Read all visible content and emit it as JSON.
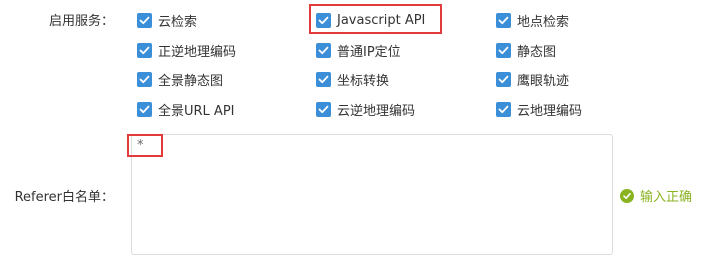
{
  "form": {
    "services_label": "启用服务：",
    "referer_label": "Referer白名单：",
    "referer_value": "*",
    "status_text": "输入正确"
  },
  "services": [
    {
      "label": "云检索",
      "checked": true
    },
    {
      "label": "Javascript API",
      "checked": true,
      "highlighted": true
    },
    {
      "label": "地点检索",
      "checked": true
    },
    {
      "label": "正逆地理编码",
      "checked": true
    },
    {
      "label": "普通IP定位",
      "checked": true
    },
    {
      "label": "静态图",
      "checked": true
    },
    {
      "label": "全景静态图",
      "checked": true
    },
    {
      "label": "坐标转换",
      "checked": true
    },
    {
      "label": "鹰眼轨迹",
      "checked": true
    },
    {
      "label": "全景URL API",
      "checked": true
    },
    {
      "label": "云逆地理编码",
      "checked": true
    },
    {
      "label": "云地理编码",
      "checked": true
    }
  ],
  "colors": {
    "checkbox": "#3b8ed8",
    "highlight": "#e23b3b",
    "success": "#8ab321",
    "text": "#333333"
  },
  "icons": {
    "checkbox": "checkmark-icon",
    "status": "check-circle-icon"
  }
}
